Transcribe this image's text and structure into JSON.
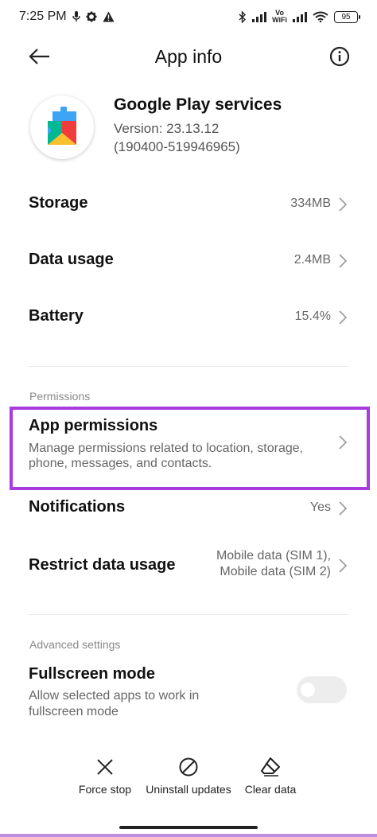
{
  "status_bar": {
    "time": "7:25 PM",
    "vowifi_top": "Vo",
    "vowifi_bottom": "WiFi",
    "battery": "95"
  },
  "header": {
    "title": "App info"
  },
  "app": {
    "name": "Google Play services",
    "version": "Version: 23.13.12",
    "build": "(190400-519946965)"
  },
  "rows": {
    "storage": {
      "label": "Storage",
      "value": "334MB"
    },
    "data_usage": {
      "label": "Data usage",
      "value": "2.4MB"
    },
    "battery": {
      "label": "Battery",
      "value": "15.4%"
    }
  },
  "permissions": {
    "section_label": "Permissions",
    "app_permissions": {
      "label": "App permissions",
      "desc_line1": "Manage permissions related to location, storage,",
      "desc_line2": "phone, messages, and contacts."
    },
    "notifications": {
      "label": "Notifications",
      "value": "Yes"
    },
    "restrict_data": {
      "label": "Restrict data usage",
      "value_line1": "Mobile data (SIM 1),",
      "value_line2": "Mobile data (SIM 2)"
    }
  },
  "advanced": {
    "section_label": "Advanced settings",
    "fullscreen": {
      "label": "Fullscreen mode",
      "desc_line1": "Allow selected apps to work in",
      "desc_line2": "fullscreen mode",
      "enabled": false
    }
  },
  "actions": {
    "force_stop": "Force stop",
    "uninstall_updates": "Uninstall updates",
    "clear_data": "Clear data"
  },
  "colors": {
    "highlight": "#a83ae0",
    "secondary_text": "#666666"
  }
}
